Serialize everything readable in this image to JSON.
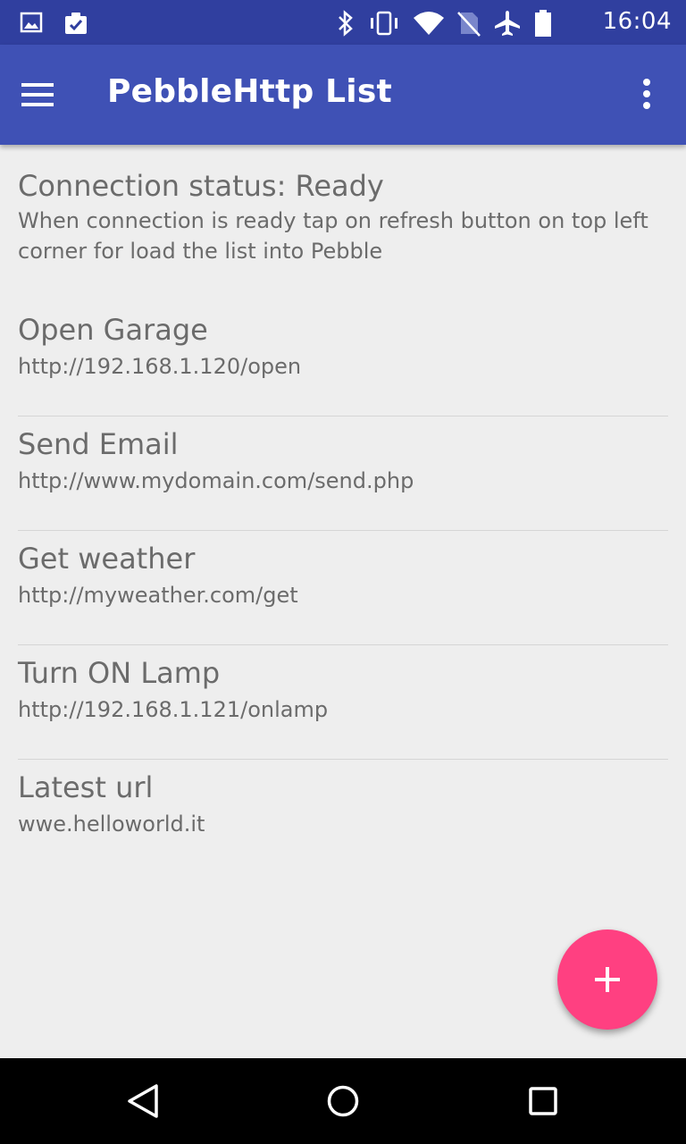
{
  "status_bar": {
    "time": "16:04",
    "left_icons": [
      "image-icon",
      "clipboard-check-icon"
    ],
    "right_icons": [
      "bluetooth-icon",
      "vibrate-icon",
      "wifi-icon",
      "no-sim-icon",
      "airplane-icon",
      "battery-icon"
    ]
  },
  "app_bar": {
    "title": "PebbleHttp List",
    "menu_icon": "hamburger-menu-icon",
    "overflow_icon": "more-vert-icon",
    "color": "#3f51b5"
  },
  "connection": {
    "status": "Connection status: Ready",
    "description": "When connection is ready tap on refresh button on top left corner for load the list into Pebble"
  },
  "items": [
    {
      "title": "Open Garage",
      "url": "http://192.168.1.120/open"
    },
    {
      "title": "Send Email",
      "url": "http://www.mydomain.com/send.php"
    },
    {
      "title": "Get weather",
      "url": "http://myweather.com/get"
    },
    {
      "title": "Turn ON Lamp",
      "url": "http://192.168.1.121/onlamp"
    },
    {
      "title": "Latest url",
      "url": "wwe.helloworld.it"
    }
  ],
  "fab": {
    "icon": "plus-icon",
    "color": "#ff4081"
  },
  "nav_bar": {
    "icons": [
      "back-triangle-icon",
      "home-circle-icon",
      "recents-square-icon"
    ]
  }
}
